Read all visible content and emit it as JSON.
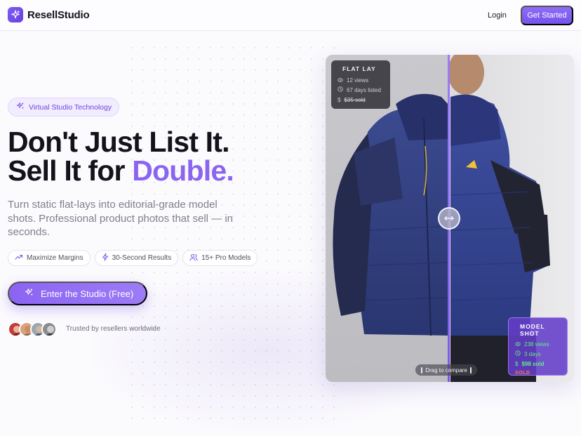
{
  "brand": {
    "name": "ResellStudio",
    "accent": "#8a65f2"
  },
  "nav": {
    "login": "Login",
    "get_started": "Get Started"
  },
  "hero": {
    "badge": "Virtual Studio Technology",
    "headline_line1": "Don't Just List It.",
    "headline_line2_prefix": "Sell It for ",
    "headline_line2_accent": "Double.",
    "subtitle": "Turn static flat-lays into editorial-grade model shots. Professional product photos that sell — in seconds.",
    "chips": [
      {
        "label": "Maximize Margins",
        "icon": "trend-up-icon"
      },
      {
        "label": "30-Second Results",
        "icon": "lightning-icon"
      },
      {
        "label": "15+ Pro Models",
        "icon": "users-icon"
      }
    ],
    "cta": "Enter the Studio (Free)",
    "trusted": "Trusted by resellers worldwide"
  },
  "compare": {
    "before": {
      "title": "FLAT LAY",
      "views": "12 views",
      "days": "67 days listed",
      "price": "$35 sold"
    },
    "after": {
      "title": "MODEL SHOT",
      "views": "238 views",
      "days": "3 days",
      "price": "$98 sold",
      "status": "SOLD"
    },
    "drag_hint": "Drag to compare"
  }
}
